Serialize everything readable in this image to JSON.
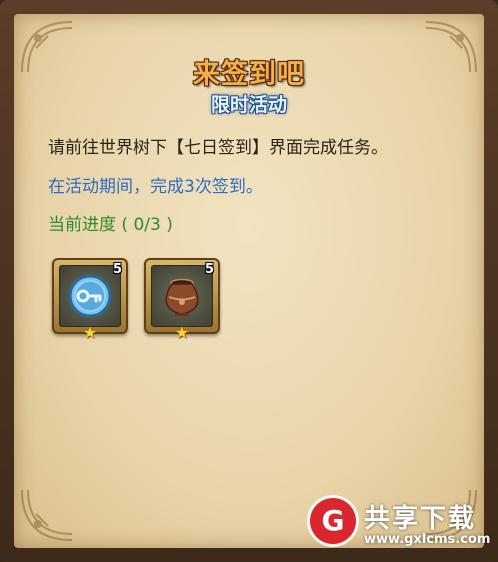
{
  "panel": {
    "title": "来签到吧",
    "subtitle": "限时活动",
    "description": "请前往世界树下【七日签到】界面完成任务。",
    "period_text": "在活动期间，完成3次签到。",
    "progress_text": "当前进度 ( 0/3 )"
  },
  "rewards": [
    {
      "icon": "key-coin-icon",
      "count": "5",
      "stars": 1
    },
    {
      "icon": "urn-vase-icon",
      "count": "5",
      "stars": 1
    }
  ],
  "watermark": {
    "name": "共享下载",
    "url": "www.gxlcms.com"
  },
  "colors": {
    "title": "#f3b04a",
    "subtitle_outline": "#1e4f86",
    "period_text": "#2d6cc4",
    "progress_text": "#2f8a2c",
    "watermark_logo": "#d8272f"
  }
}
